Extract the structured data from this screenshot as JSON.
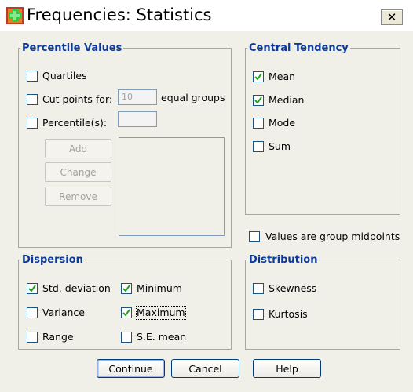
{
  "window": {
    "title": "Frequencies: Statistics",
    "close_glyph": "✕"
  },
  "percentile_values": {
    "legend": "Percentile Values",
    "quartiles": {
      "label": "Quartiles",
      "checked": false
    },
    "cut_points": {
      "label": "Cut points for:",
      "checked": false,
      "value": "10",
      "suffix": "equal groups"
    },
    "percentiles": {
      "label": "Percentile(s):",
      "checked": false,
      "value": ""
    },
    "add_label": "Add",
    "change_label": "Change",
    "remove_label": "Remove"
  },
  "central_tendency": {
    "legend": "Central Tendency",
    "items": [
      {
        "label": "Mean",
        "checked": true
      },
      {
        "label": "Median",
        "checked": true
      },
      {
        "label": "Mode",
        "checked": false
      },
      {
        "label": "Sum",
        "checked": false
      }
    ]
  },
  "group_midpoints": {
    "label": "Values are group midpoints",
    "checked": false
  },
  "dispersion": {
    "legend": "Dispersion",
    "std_deviation": {
      "label": "Std. deviation",
      "checked": true
    },
    "minimum": {
      "label": "Minimum",
      "checked": true
    },
    "variance": {
      "label": "Variance",
      "checked": false
    },
    "maximum": {
      "label": "Maximum",
      "checked": true
    },
    "range": {
      "label": "Range",
      "checked": false
    },
    "se_mean": {
      "label": "S.E. mean",
      "checked": false
    }
  },
  "distribution": {
    "legend": "Distribution",
    "skewness": {
      "label": "Skewness",
      "checked": false
    },
    "kurtosis": {
      "label": "Kurtosis",
      "checked": false
    }
  },
  "buttons": {
    "continue": "Continue",
    "cancel": "Cancel",
    "help": "Help"
  },
  "colors": {
    "legend_text": "#0b3a9a",
    "check": "#21a121",
    "checkbox_border": "#1c5180",
    "dialog_bg": "#f0efe8"
  }
}
